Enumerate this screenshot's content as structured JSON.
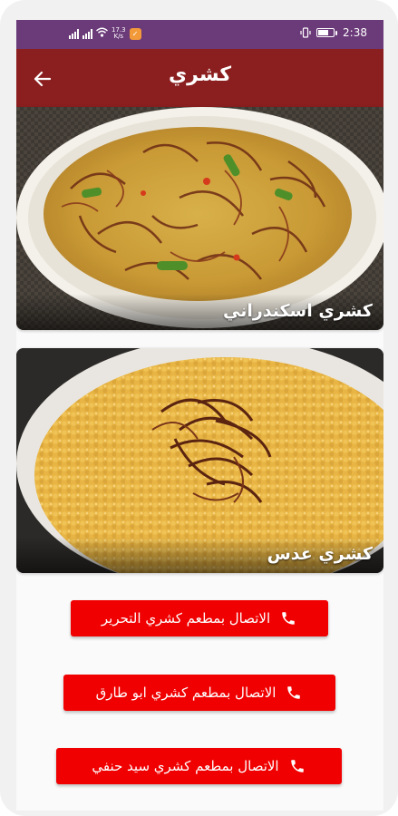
{
  "status_bar": {
    "network_speed_top": "17.3",
    "network_speed_bottom": "K/s",
    "time": "2:38",
    "icons": [
      "signal-icon",
      "wifi-icon",
      "notification-icon",
      "vibrate-icon",
      "battery-icon"
    ]
  },
  "app_bar": {
    "title": "كشري",
    "back_icon": "arrow-right-icon"
  },
  "recipes": [
    {
      "title": "كشري اسكندراني"
    },
    {
      "title": "كشري عدس"
    }
  ],
  "call_buttons": [
    {
      "label": "الاتصال بمطعم كشري التحرير",
      "icon": "phone-icon"
    },
    {
      "label": "الاتصال بمطعم كشري ابو طارق",
      "icon": "phone-icon"
    },
    {
      "label": "الاتصال بمطعم كشري سيد حنفي",
      "icon": "phone-icon"
    }
  ],
  "colors": {
    "status_bar": "#6b3a79",
    "app_bar": "#8b1f1f",
    "call_button": "#f00000"
  }
}
